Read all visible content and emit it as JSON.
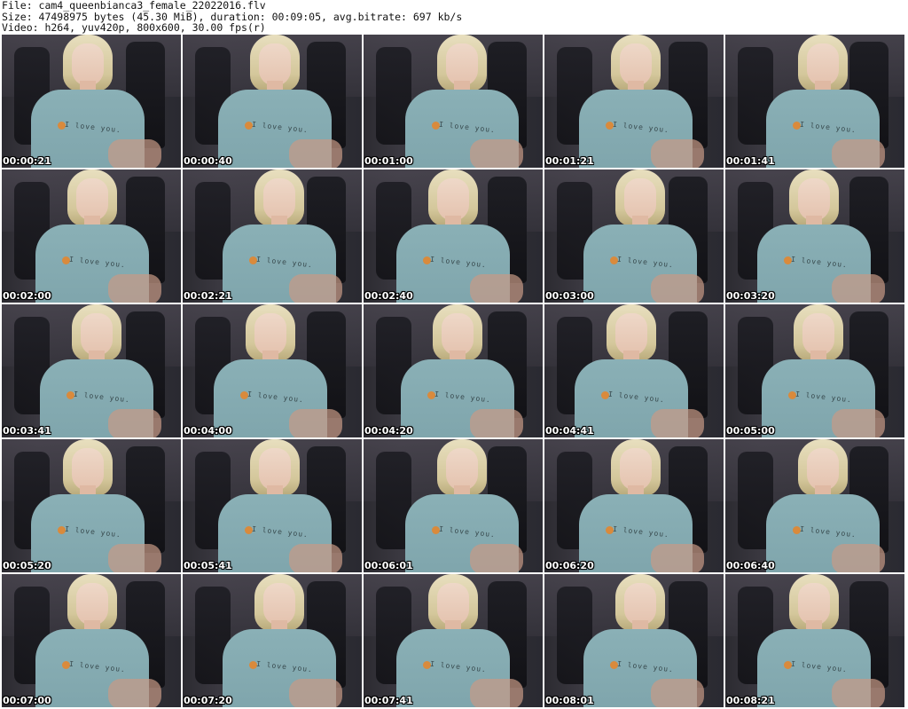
{
  "header": {
    "file_line": "File: cam4_queenbianca3_female_22022016.flv",
    "size_line": "Size: 47498975 bytes (45.30 MiB), duration: 00:09:05, avg.bitrate: 697 kb/s",
    "video_line": "Video: h264, yuv420p, 800x600, 30.00 fps(r)"
  },
  "thumbnails": [
    {
      "timestamp": "00:00:21"
    },
    {
      "timestamp": "00:00:40"
    },
    {
      "timestamp": "00:01:00"
    },
    {
      "timestamp": "00:01:21"
    },
    {
      "timestamp": "00:01:41"
    },
    {
      "timestamp": "00:02:00"
    },
    {
      "timestamp": "00:02:21"
    },
    {
      "timestamp": "00:02:40"
    },
    {
      "timestamp": "00:03:00"
    },
    {
      "timestamp": "00:03:20"
    },
    {
      "timestamp": "00:03:41"
    },
    {
      "timestamp": "00:04:00"
    },
    {
      "timestamp": "00:04:20"
    },
    {
      "timestamp": "00:04:41"
    },
    {
      "timestamp": "00:05:00"
    },
    {
      "timestamp": "00:05:20"
    },
    {
      "timestamp": "00:05:41"
    },
    {
      "timestamp": "00:06:01"
    },
    {
      "timestamp": "00:06:20"
    },
    {
      "timestamp": "00:06:40"
    },
    {
      "timestamp": "00:07:00"
    },
    {
      "timestamp": "00:07:20"
    },
    {
      "timestamp": "00:07:41"
    },
    {
      "timestamp": "00:08:01"
    },
    {
      "timestamp": "00:08:21"
    }
  ],
  "shirt_text": "I love you."
}
